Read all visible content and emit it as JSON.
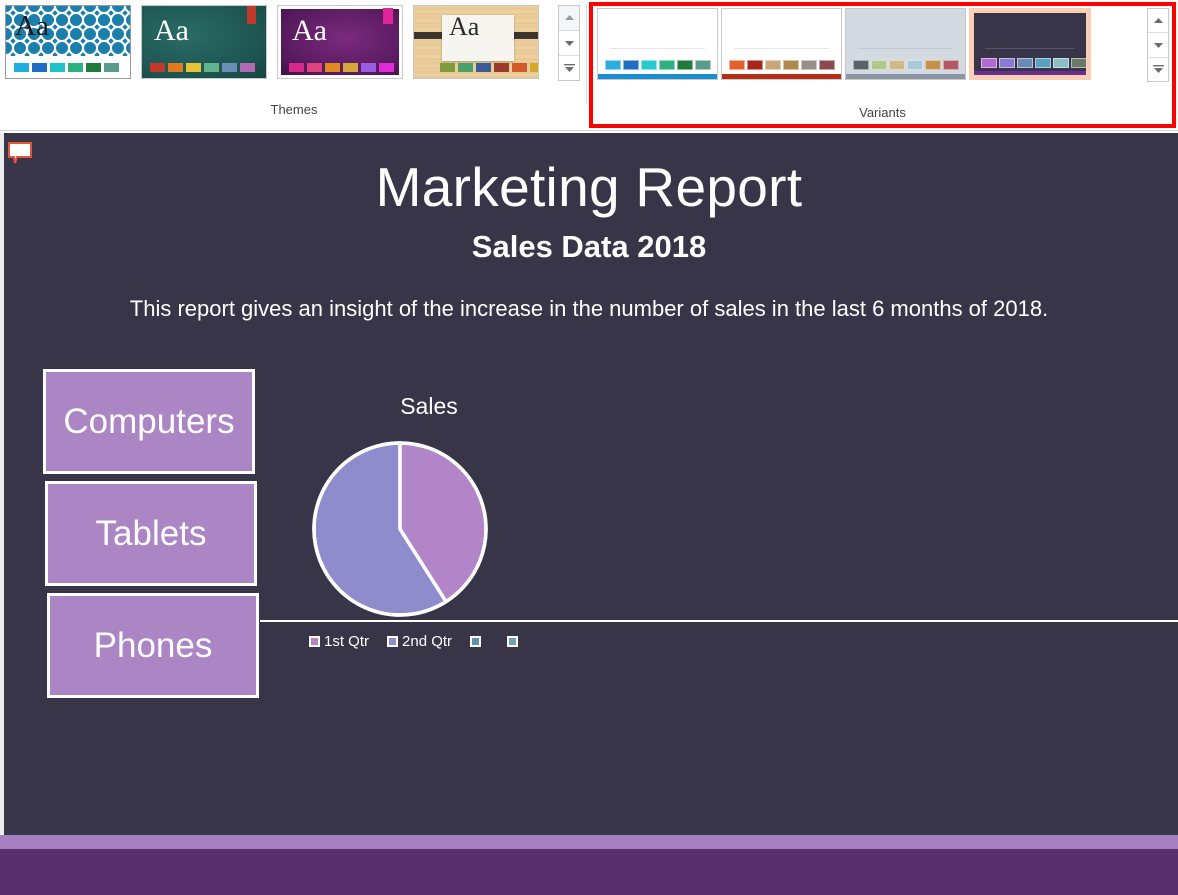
{
  "ribbon": {
    "themes": {
      "label": "Themes",
      "thumbnails": [
        {
          "name": "blue-tile-theme",
          "aa": "Aa",
          "selected": true,
          "swatches": [
            "#1fb0e0",
            "#1f6fc4",
            "#1fc2c9",
            "#2bb27f",
            "#1f7a3c",
            "#5a9c8c"
          ]
        },
        {
          "name": "teal-chalk-theme",
          "aa": "Aa",
          "swatches": [
            "#c0392b",
            "#e07a20",
            "#e8c33a",
            "#61b38c",
            "#6a8cb5",
            "#b06ab0"
          ]
        },
        {
          "name": "purple-gradient-theme",
          "aa": "Aa",
          "swatches": [
            "#d62a8a",
            "#e0447f",
            "#e08a1f",
            "#d6a83a",
            "#9a5ce0",
            "#e02ad6"
          ]
        },
        {
          "name": "wood-paper-theme",
          "aa": "Aa",
          "swatches": [
            "#7f9a3a",
            "#4aa06a",
            "#3a5a9a",
            "#9a3a2a",
            "#d05a2a",
            "#d6a82a"
          ]
        }
      ],
      "scroll": {
        "up": "scroll-up",
        "down": "scroll-down",
        "more": "more-themes"
      }
    },
    "variants": {
      "label": "Variants",
      "highlighted": true,
      "thumbnails": [
        {
          "name": "variant-blue",
          "bg": "#ffffff",
          "bar": "#1b8fd1",
          "selected": false,
          "swatches": [
            "#2aaee0",
            "#1f6fc4",
            "#2ac9d0",
            "#2bb27f",
            "#1f7a3c",
            "#5a9c8c"
          ]
        },
        {
          "name": "variant-red",
          "bg": "#ffffff",
          "bar": "#b52e16",
          "selected": false,
          "swatches": [
            "#e2622a",
            "#a8261a",
            "#c9a676",
            "#b08a4a",
            "#9a8e8a",
            "#8a4a50"
          ]
        },
        {
          "name": "variant-gray",
          "bg": "#d4dae2",
          "bar": "#8a96a3",
          "selected": false,
          "swatches": [
            "#5c6068",
            "#afc98a",
            "#d1b88a",
            "#a8c9d8",
            "#c4914a",
            "#b05a66"
          ]
        },
        {
          "name": "variant-dark-purple",
          "bg": "#383549",
          "bar": "#6b2f8f",
          "selected": true,
          "swatches": [
            "#b06ad0",
            "#8a7ad0",
            "#6a8ab5",
            "#5aa0c0",
            "#8ac0c4",
            "#6a7a66"
          ]
        }
      ],
      "scroll": {
        "up": "scroll-up",
        "down": "scroll-down",
        "more": "more-variants"
      }
    }
  },
  "slide": {
    "background_color": "#383549",
    "comment_marker": "comment-bubble",
    "title": "Marketing Report",
    "subtitle": "Sales Data 2018",
    "description": "This report gives an insight of the increase in the number of sales in the last 6 months of 2018.",
    "categories": [
      {
        "label": "Computers"
      },
      {
        "label": "Tablets"
      },
      {
        "label": "Phones"
      }
    ],
    "accent_bar_light": "#a57fc0",
    "accent_bar_dark": "#58306e"
  },
  "chart_data": {
    "type": "pie",
    "title": "Sales",
    "categories": [
      "1st Qtr",
      "2nd Qtr",
      "",
      ""
    ],
    "values": [
      41,
      59,
      0,
      0
    ],
    "colors": [
      "#b285c8",
      "#8e8ccd",
      "#5f93a8",
      "#6fa0b4"
    ],
    "legend": [
      "1st Qtr",
      "2nd Qtr",
      "",
      ""
    ],
    "legend_position": "bottom",
    "grid": false,
    "xlabel": "",
    "ylabel": ""
  }
}
